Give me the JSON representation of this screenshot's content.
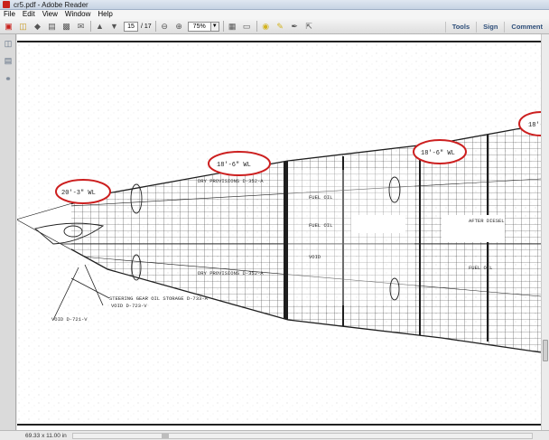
{
  "window": {
    "title": "cr5.pdf - Adobe Reader"
  },
  "menu": {
    "items": [
      "File",
      "Edit",
      "View",
      "Window",
      "Help"
    ]
  },
  "toolbar": {
    "page_current": "15",
    "page_total": "/ 17",
    "zoom": "75%",
    "links": {
      "tools": "Tools",
      "sign": "Sign",
      "comment": "Comment"
    }
  },
  "status": {
    "page_size": "69.33 x 11.00 in"
  },
  "drawing": {
    "circled_labels": [
      "20'-3\" WL",
      "18'-6\" WL",
      "18'-6\" WL",
      "18'-"
    ],
    "labels": {
      "steering": "STEERING GEAR OIL STORAGE D-733-A",
      "void1": "VOID D-723-V",
      "void2": "VOID D-721-V",
      "dry_provisions_1": "DRY PROVISIONS D-352-A",
      "dry_provisions_2": "DRY PROVISIONS D-352-A",
      "fuel_oil_1": "FUEL OIL",
      "fuel_oil_2": "FUEL OIL",
      "void3": "VOID",
      "after_diesel": "AFTER DIESEL",
      "fuel_oil_3": "FUEL OIL"
    }
  },
  "colors": {
    "annotation": "#cc1f1f",
    "ink": "#2a2a2a",
    "highlight": "#ffffff"
  }
}
